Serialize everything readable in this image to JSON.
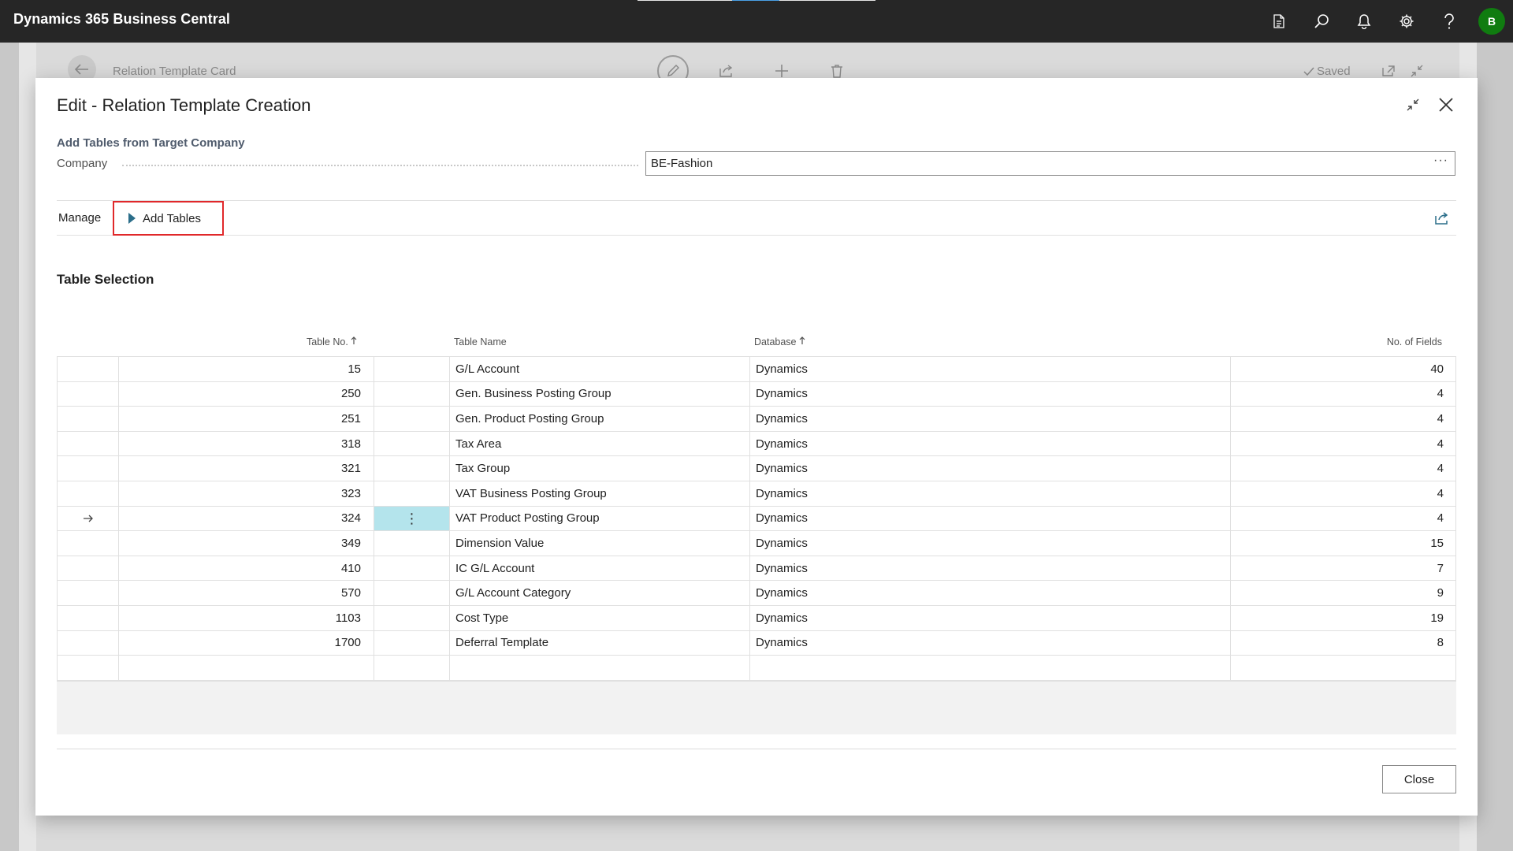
{
  "app": {
    "title": "Dynamics 365 Business Central",
    "avatar_initial": "B"
  },
  "appbar_icons": [
    "document-icon",
    "search-icon",
    "bell-icon",
    "gear-icon",
    "help-icon"
  ],
  "background_page": {
    "title": "Relation Template Card",
    "saved_label": "Saved"
  },
  "dialog": {
    "title": "Edit - Relation Template Creation",
    "group_caption": "Add Tables from Target Company",
    "company_label": "Company",
    "company_value": "BE-Fashion",
    "ellipsis": "···",
    "actions": {
      "manage": "Manage",
      "add_tables": "Add Tables"
    },
    "section_title": "Table Selection",
    "columns": {
      "table_no": "Table No.",
      "table_name": "Table Name",
      "database": "Database",
      "no_of_fields": "No. of Fields"
    },
    "rows": [
      {
        "no": "15",
        "name": "G/L Account",
        "db": "Dynamics",
        "fields": "40"
      },
      {
        "no": "250",
        "name": "Gen. Business Posting Group",
        "db": "Dynamics",
        "fields": "4"
      },
      {
        "no": "251",
        "name": "Gen. Product Posting Group",
        "db": "Dynamics",
        "fields": "4"
      },
      {
        "no": "318",
        "name": "Tax Area",
        "db": "Dynamics",
        "fields": "4"
      },
      {
        "no": "321",
        "name": "Tax Group",
        "db": "Dynamics",
        "fields": "4"
      },
      {
        "no": "323",
        "name": "VAT Business Posting Group",
        "db": "Dynamics",
        "fields": "4"
      },
      {
        "no": "324",
        "name": "VAT Product Posting Group",
        "db": "Dynamics",
        "fields": "4",
        "selected": true
      },
      {
        "no": "349",
        "name": "Dimension Value",
        "db": "Dynamics",
        "fields": "15"
      },
      {
        "no": "410",
        "name": "IC G/L Account",
        "db": "Dynamics",
        "fields": "7"
      },
      {
        "no": "570",
        "name": "G/L Account Category",
        "db": "Dynamics",
        "fields": "9"
      },
      {
        "no": "1103",
        "name": "Cost Type",
        "db": "Dynamics",
        "fields": "19"
      },
      {
        "no": "1700",
        "name": "Deferral Template",
        "db": "Dynamics",
        "fields": "8"
      }
    ],
    "close_label": "Close"
  },
  "colors": {
    "appbar": "#262626",
    "avatar": "#107c10",
    "highlight_box": "#e0282a",
    "selected_cell": "#b4e4ec",
    "accent": "#2b6e8a"
  }
}
